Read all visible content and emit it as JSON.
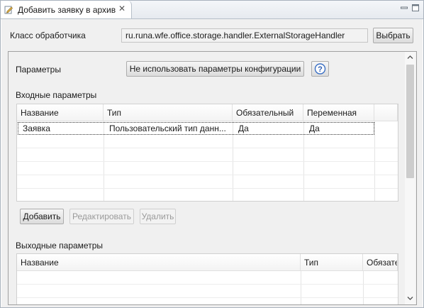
{
  "tab": {
    "title": "Добавить заявку в архив",
    "icon": "edit-dialog-icon",
    "close_glyph": "✕"
  },
  "handler": {
    "label": "Класс обработчика",
    "value": "ru.runa.wfe.office.storage.handler.ExternalStorageHandler",
    "choose_button": "Выбрать"
  },
  "params": {
    "label": "Параметры",
    "config_button": "Не использовать параметры конфигурации",
    "help_glyph": "?"
  },
  "input_params": {
    "title": "Входные параметры",
    "columns": [
      "Название",
      "Тип",
      "Обязательный",
      "Переменная"
    ],
    "rows": [
      [
        "Заявка",
        "Пользовательский тип данн...",
        "Да",
        "Да"
      ]
    ],
    "buttons": {
      "add": "Добавить",
      "edit": "Редактировать",
      "delete": "Удалить"
    }
  },
  "output_params": {
    "title": "Выходные параметры",
    "columns": [
      "Название",
      "Тип",
      "Обязате"
    ]
  },
  "colors": {
    "tab_border": "#a9b2bd",
    "background": "#f0f0f0",
    "help_ring": "#3a6fc4"
  }
}
